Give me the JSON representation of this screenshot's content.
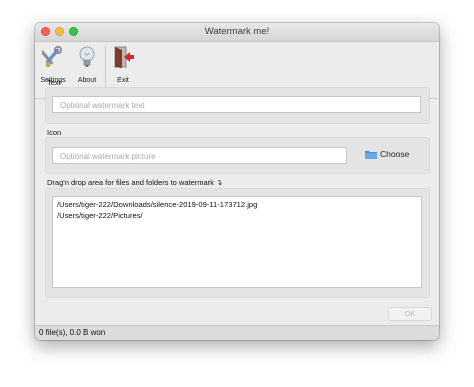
{
  "window": {
    "title": "Watermark me!"
  },
  "toolbar": {
    "settings_label": "Settings",
    "about_label": "About",
    "exit_label": "Exit"
  },
  "text_section": {
    "label": "Text",
    "placeholder": "Optional watermark text"
  },
  "icon_section": {
    "label": "Icon",
    "placeholder": "Optional watermark picture",
    "choose_label": "Choose"
  },
  "drop_section": {
    "label": "Drag'n drop area for files and folders to watermark ↴",
    "items": [
      "/Users/tiger-222/Downloads/silence-2019-09-11-173712.jpg",
      "/Users/tiger-222/Pictures/"
    ]
  },
  "ok_label": "OK",
  "status": {
    "text": "0 file(s), 0.0 B won"
  },
  "colors": {
    "close": "#fc605b",
    "minimize": "#fdbc40",
    "maximize": "#34c84a",
    "window_bg": "#ececec",
    "exit_arrow": "#d9262b"
  },
  "icons": {
    "settings": "tools-icon",
    "about": "lightbulb-icon",
    "exit": "exit-door-icon",
    "choose": "folder-icon"
  }
}
